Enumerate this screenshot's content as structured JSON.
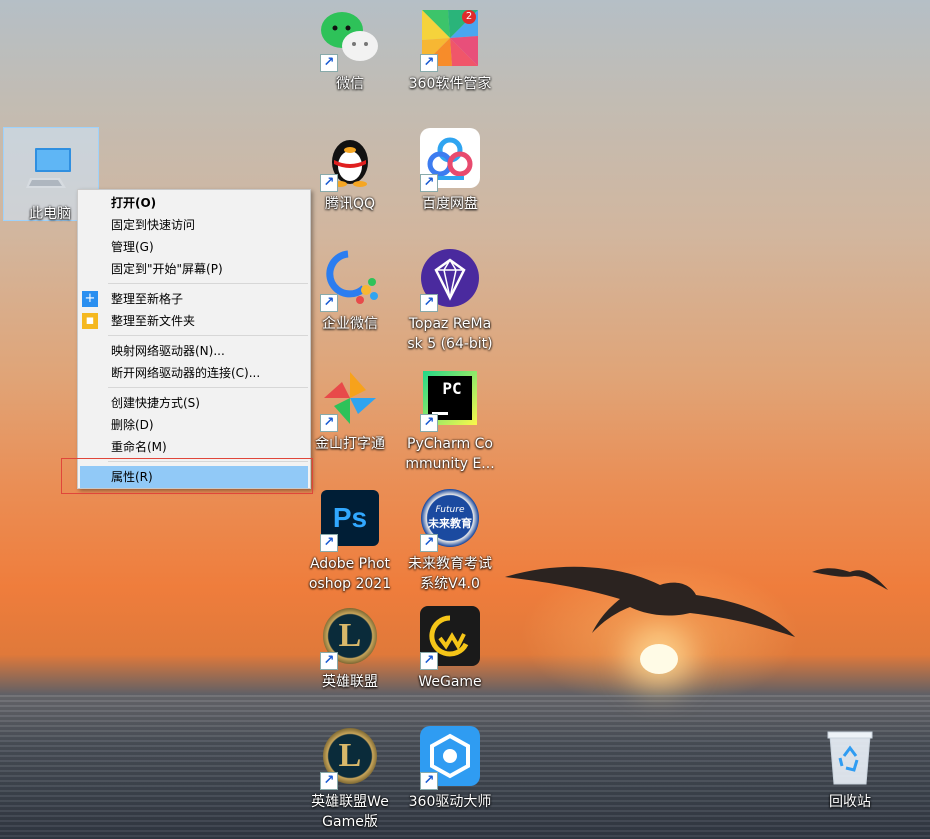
{
  "desktop": {
    "this_pc_label": "此电脑",
    "recycle_bin_label": "回收站",
    "icons": [
      {
        "id": "wechat",
        "label": "微信"
      },
      {
        "id": "360soft",
        "label": "360软件管家",
        "badge": "2"
      },
      {
        "id": "qq",
        "label": "腾讯QQ"
      },
      {
        "id": "baidu",
        "label": "百度网盘"
      },
      {
        "id": "wework",
        "label": "企业微信"
      },
      {
        "id": "topaz",
        "label": "Topaz ReMask 5 (64-bit)",
        "lines": [
          "Topaz ReMa",
          "sk 5 (64-bit)"
        ]
      },
      {
        "id": "jinshan",
        "label": "金山打字通"
      },
      {
        "id": "pycharm",
        "label": "PyCharm Community E...",
        "lines": [
          "PyCharm Co",
          "mmunity E..."
        ],
        "glyph": "PC"
      },
      {
        "id": "photoshop",
        "label": "Adobe Photoshop 2021",
        "lines": [
          "Adobe Phot",
          "oshop 2021"
        ],
        "glyph": "Ps"
      },
      {
        "id": "weilai",
        "label": "未来教育考试系统V4.0",
        "lines": [
          "未来教育考试",
          "系统V4.0"
        ],
        "glyph_top": "Future",
        "glyph": "未来教育"
      },
      {
        "id": "lol",
        "label": "英雄联盟",
        "glyph": "L"
      },
      {
        "id": "wegame",
        "label": "WeGame"
      },
      {
        "id": "lolwegame",
        "label": "英雄联盟WeGame版",
        "lines": [
          "英雄联盟We",
          "Game版"
        ],
        "glyph": "L"
      },
      {
        "id": "360driver",
        "label": "360驱动大师"
      }
    ]
  },
  "context_menu": {
    "items": [
      {
        "label": "打开(O)"
      },
      {
        "label": "固定到快速访问"
      },
      {
        "label": "管理(G)"
      },
      {
        "label": "固定到\"开始\"屏幕(P)"
      },
      {
        "label": "整理至新格子",
        "icon": "plus-icon"
      },
      {
        "label": "整理至新文件夹",
        "icon": "folder-icon"
      },
      {
        "label": "映射网络驱动器(N)..."
      },
      {
        "label": "断开网络驱动器的连接(C)..."
      },
      {
        "label": "创建快捷方式(S)"
      },
      {
        "label": "删除(D)"
      },
      {
        "label": "重命名(M)"
      },
      {
        "label": "属性(R)"
      }
    ]
  },
  "colors": {
    "highlight": "#91c9f7",
    "annotation_box": "#e0463a",
    "shortcut_arrow": "#1a5bd4"
  }
}
